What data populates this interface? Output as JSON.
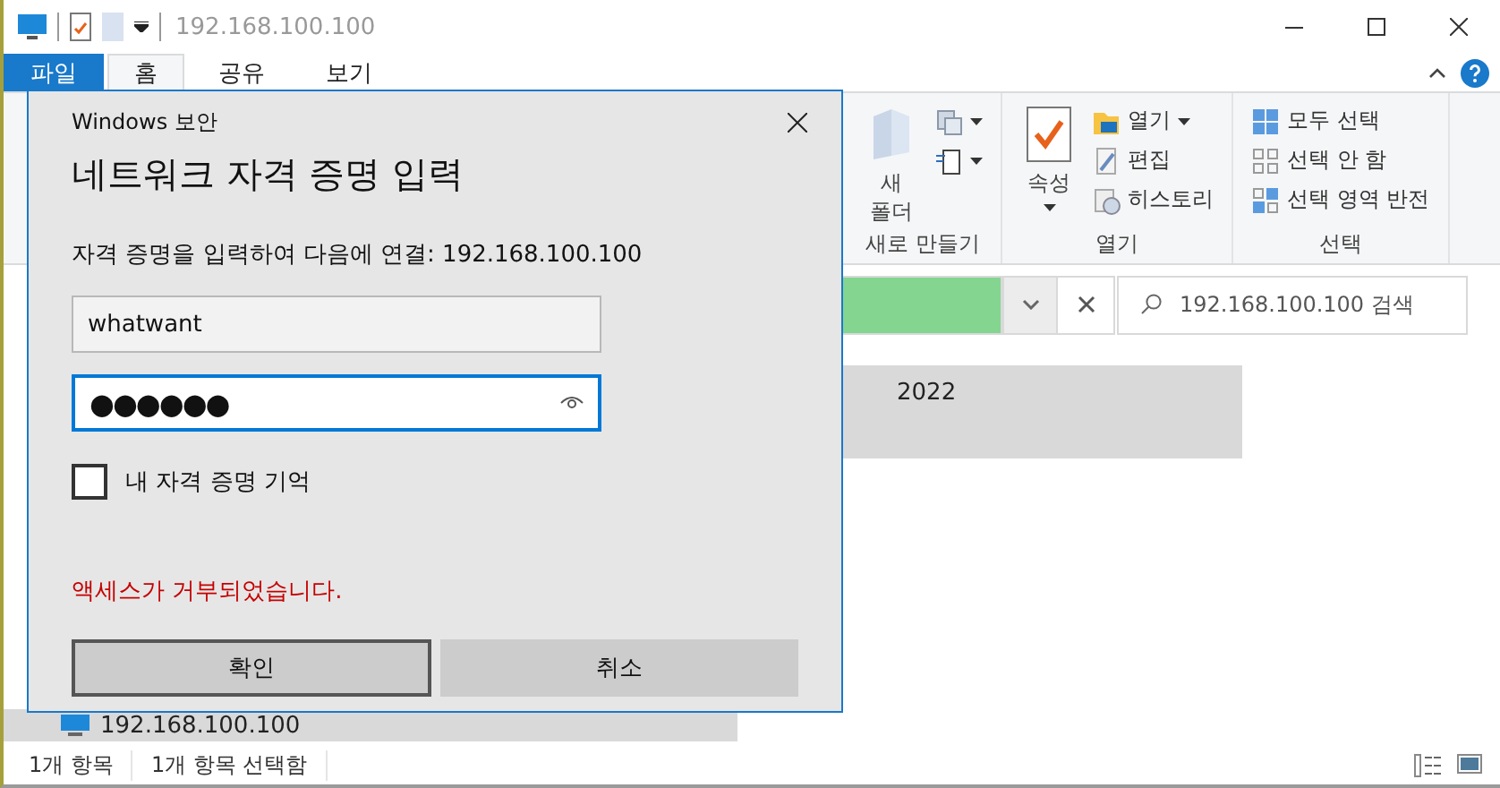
{
  "window": {
    "title": "192.168.100.100"
  },
  "ribbon_tabs": [
    {
      "label": "파일",
      "kind": "file",
      "selected": false
    },
    {
      "label": "홈",
      "kind": "tab",
      "selected": true
    },
    {
      "label": "공유",
      "kind": "tab",
      "selected": false
    },
    {
      "label": "보기",
      "kind": "tab",
      "selected": false
    }
  ],
  "ribbon_groups": [
    {
      "title": "새로 만들기",
      "items": [
        {
          "label": "새\n폴더",
          "kind": "large"
        },
        {
          "kind": "small-icon"
        },
        {
          "kind": "small-icon"
        }
      ]
    },
    {
      "title": "열기",
      "items": [
        {
          "label": "속성",
          "kind": "large-dropdown"
        },
        {
          "label": "열기",
          "kind": "small-dropdown"
        },
        {
          "label": "편집",
          "kind": "small"
        },
        {
          "label": "히스토리",
          "kind": "small"
        }
      ]
    },
    {
      "title": "선택",
      "items": [
        {
          "label": "모두 선택",
          "kind": "small"
        },
        {
          "label": "선택 안 함",
          "kind": "small"
        },
        {
          "label": "선택 영역 반전",
          "kind": "small"
        }
      ]
    }
  ],
  "address_bar": {
    "level": 1
  },
  "search": {
    "placeholder": "192.168.100.100 검색"
  },
  "files": [
    {
      "name": "2022",
      "selected": true
    }
  ],
  "nav_pane": {
    "items": [
      {
        "label": "192.168.100.100",
        "selected": true
      }
    ]
  },
  "status_bar": [
    "1개 항목",
    "1개 항목 선택함"
  ],
  "dialog": {
    "title": "Windows 보안",
    "heading": "네트워크 자격 증명 입력",
    "prompt": "자격 증명을 입력하여 다음에 연결: 192.168.100.100",
    "username": "whatwant",
    "password": "●●●●●●",
    "remember": {
      "label": "내 자격 증명 기억",
      "checked": false
    },
    "error": "액세스가 거부되었습니다.",
    "buttons": [
      {
        "label": "확인",
        "default": true
      },
      {
        "label": "취소",
        "default": false
      }
    ]
  }
}
